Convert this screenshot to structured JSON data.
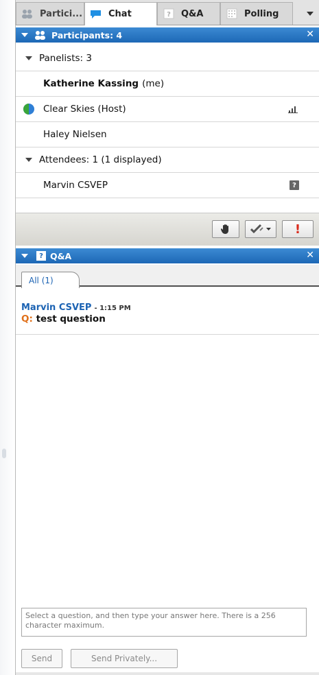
{
  "tabs": [
    {
      "label": "Partici...",
      "icon": "participants-icon"
    },
    {
      "label": "Chat",
      "icon": "chat-bubble-icon"
    },
    {
      "label": "Q&A",
      "icon": "question-box-icon"
    },
    {
      "label": "Polling",
      "icon": "polling-grid-icon"
    }
  ],
  "participants": {
    "header": "Participants: 4",
    "panelists_group": "Panelists: 3",
    "panelists": [
      {
        "name": "Katherine Kassing",
        "suffix": "(me)"
      },
      {
        "name": "Clear Skies (Host)"
      },
      {
        "name": "Haley Nielsen"
      }
    ],
    "attendees_group": "Attendees: 1 (1 displayed)",
    "attendees": [
      {
        "name": "Marvin CSVEP",
        "badge": "?"
      }
    ]
  },
  "toolbar": {
    "alert_label": "!"
  },
  "qa": {
    "header": "Q&A",
    "header_icon_text": "?",
    "tab_label": "All (1)",
    "questions": [
      {
        "asker": "Marvin CSVEP",
        "time": "- 1:15 PM",
        "prefix": "Q:",
        "text": "test question"
      }
    ],
    "answer_placeholder": "Select a question, and then type your answer here. There is a 256 character maximum.",
    "send_label": "Send",
    "send_private_label": "Send Privately..."
  },
  "colors": {
    "header_blue": "#1d68b6",
    "link_blue": "#1c63b3",
    "q_orange": "#e0701a",
    "alert_red": "#d92b1c"
  }
}
